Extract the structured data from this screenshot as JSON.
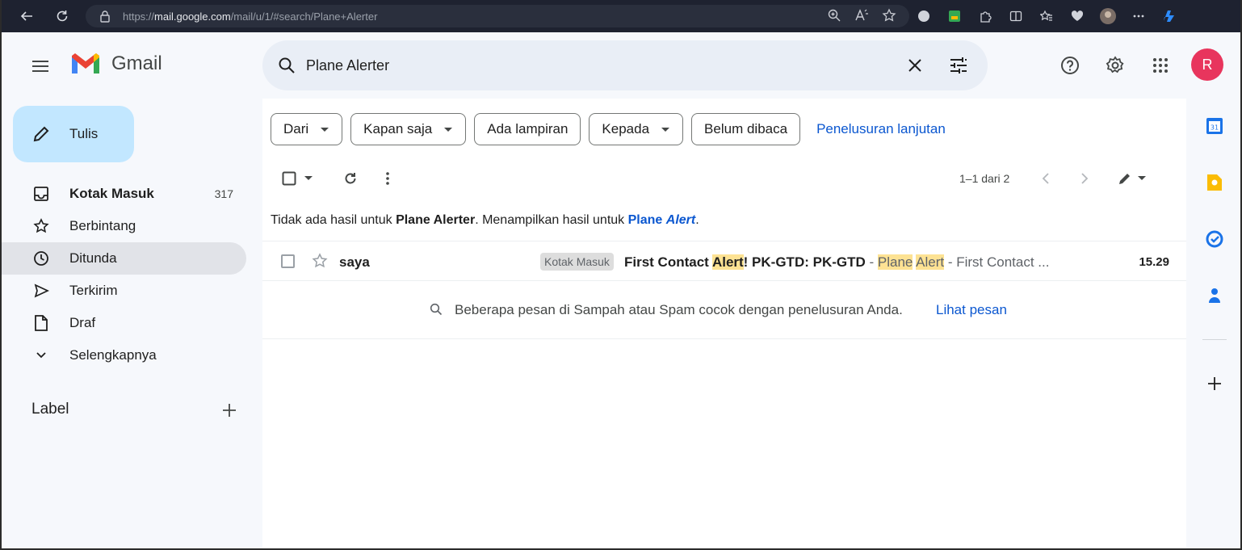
{
  "browser": {
    "url_prefix": "https://",
    "url_domain": "mail.google.com",
    "url_path": "/mail/u/1/#search/Plane+Alerter"
  },
  "gmail": {
    "logo_text": "Gmail",
    "search_value": "Plane Alerter",
    "avatar_letter": "R"
  },
  "leftnav": {
    "compose_label": "Tulis",
    "items": [
      {
        "label": "Kotak Masuk",
        "count": "317",
        "icon": "inbox-icon"
      },
      {
        "label": "Berbintang",
        "count": "",
        "icon": "star-icon"
      },
      {
        "label": "Ditunda",
        "count": "",
        "icon": "clock-icon"
      },
      {
        "label": "Terkirim",
        "count": "",
        "icon": "send-icon"
      },
      {
        "label": "Draf",
        "count": "",
        "icon": "draft-icon"
      },
      {
        "label": "Selengkapnya",
        "count": "",
        "icon": "chevron-down-icon"
      }
    ],
    "labels_header": "Label"
  },
  "filters": {
    "from": "Dari",
    "anytime": "Kapan saja",
    "has_attachment": "Ada lampiran",
    "to": "Kepada",
    "unread": "Belum dibaca",
    "advanced": "Penelusuran lanjutan"
  },
  "toolbar": {
    "pagination": "1–1 dari 2"
  },
  "notice": {
    "prefix": "Tidak ada hasil untuk ",
    "query": "Plane Alerter",
    "middle": ". Menampilkan hasil untuk ",
    "corrected_1": "Plane ",
    "corrected_2": "Alert",
    "suffix": "."
  },
  "email_row": {
    "sender": "saya",
    "tag": "Kotak Masuk",
    "subject_1": "First Contact ",
    "subject_hl_1": "Alert",
    "subject_2": "! PK-GTD: PK-GTD",
    "sep_1": " - ",
    "snippet_hl_plane": "Plane",
    "snippet_space": " ",
    "snippet_hl_alert": "Alert",
    "snippet_rest": " - First Contact ...",
    "time": "15.29"
  },
  "spam_note": {
    "text": "Beberapa pesan di Sampah atau Spam cocok dengan penelusuran Anda.",
    "link": "Lihat pesan"
  },
  "colors": {
    "compose_bg": "#c2e7ff",
    "link_blue": "#0b57d0",
    "highlight": "#fde293",
    "avatar_bg": "#e8355d"
  }
}
